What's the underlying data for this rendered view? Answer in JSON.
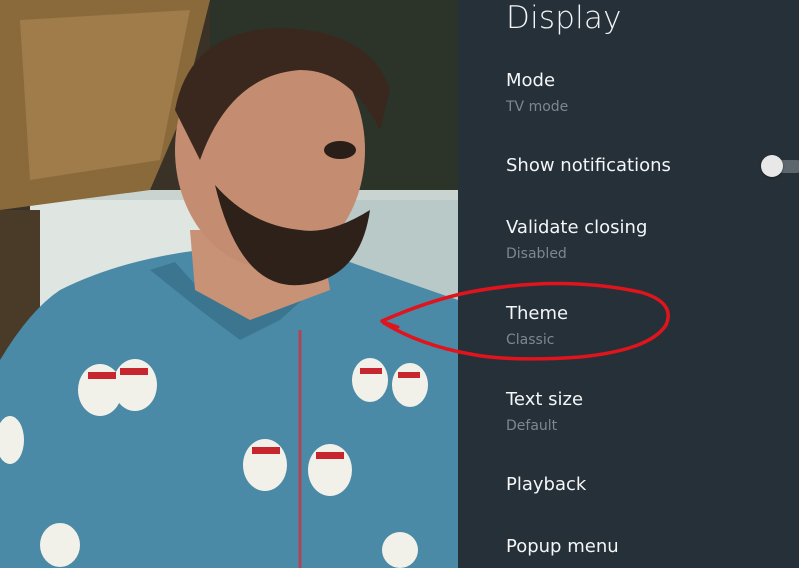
{
  "panel": {
    "title": "Display",
    "items": [
      {
        "label": "Mode",
        "value": "TV mode"
      },
      {
        "label": "Show notifications",
        "toggle_on": false
      },
      {
        "label": "Validate closing",
        "value": "Disabled"
      },
      {
        "label": "Theme",
        "value": "Classic"
      },
      {
        "label": "Text size",
        "value": "Default"
      },
      {
        "label": "Playback"
      },
      {
        "label": "Popup menu"
      }
    ]
  },
  "colors": {
    "panel_bg": "#263038",
    "annotation": "#e0141c"
  },
  "icons": [
    "toggle-switch-icon"
  ]
}
